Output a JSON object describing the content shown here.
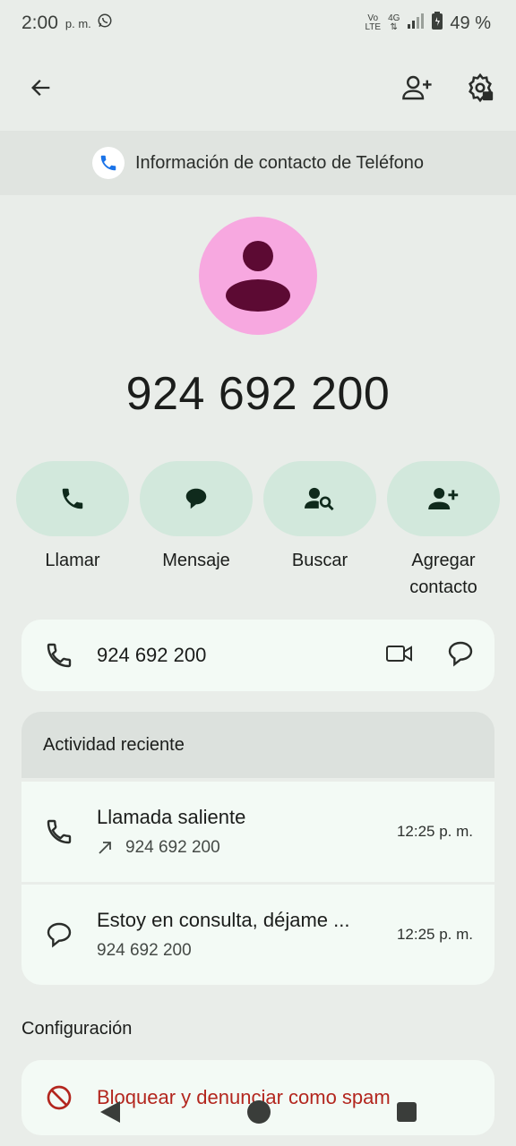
{
  "status_bar": {
    "time": "2:00",
    "ampm": "p. m.",
    "volte_top": "Vo",
    "volte_bottom": "LTE",
    "network": "4G",
    "battery": "49 %"
  },
  "banner": {
    "text": "Información de contacto de Teléfono"
  },
  "contact": {
    "number": "924 692 200"
  },
  "quick_actions": [
    {
      "label": "Llamar"
    },
    {
      "label": "Mensaje"
    },
    {
      "label": "Buscar"
    },
    {
      "label": "Agregar contacto"
    }
  ],
  "phone_card": {
    "number": "924 692 200"
  },
  "recent_activity": {
    "title": "Actividad reciente",
    "items": [
      {
        "title": "Llamada saliente",
        "subtitle": "924 692 200",
        "time": "12:25 p. m."
      },
      {
        "title": "Estoy en consulta, déjame ...",
        "subtitle": "924 692 200",
        "time": "12:25 p. m."
      }
    ]
  },
  "settings": {
    "title": "Configuración",
    "block_label": "Bloquear y denunciar como spam"
  },
  "colors": {
    "background": "#e9ede9",
    "card": "#f3faf5",
    "pill": "#d2e8dc",
    "avatar": "#f7a8e0",
    "avatar_icon": "#5c0a33",
    "danger": "#b3261e"
  }
}
